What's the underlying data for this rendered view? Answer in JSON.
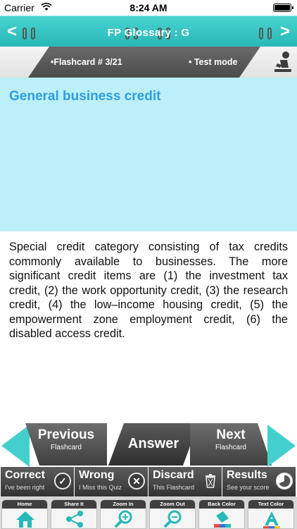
{
  "status_bar": {
    "carrier": "Carrier",
    "time": "8:24 AM"
  },
  "header": {
    "title": "FP Glossary : G",
    "back_icon": "chevron-left-icon",
    "forward_icon": "chevron-right-icon",
    "accent": "#33c3c1"
  },
  "info_bar": {
    "flashcard_label": "•Flashcard #  3/21",
    "mode_label": "• Test mode"
  },
  "card": {
    "term": "General business credit",
    "term_color": "#2d9fe0",
    "term_background": "#bdeff8",
    "definition": "Special credit category consisting of tax credits commonly available to businesses. The more significant credit items are (1) the investment tax credit, (2) the work opportunity credit, (3) the research credit, (4) the low–income housing credit, (5) the empowerment zone employment credit, (6) the disabled access credit."
  },
  "navigation": {
    "previous": {
      "label": "Previous",
      "sub": "Flashcard"
    },
    "answer": {
      "label": "Answer"
    },
    "next": {
      "label": "Next",
      "sub": "Flashcard"
    }
  },
  "actions": [
    {
      "label": "Correct",
      "sub": "I've been right",
      "icon": "checkmark-icon"
    },
    {
      "label": "Wrong",
      "sub": "I Miss this Quiz",
      "icon": "x-icon"
    },
    {
      "label": "Discard",
      "sub": "This Flashcard",
      "icon": "trash-icon"
    },
    {
      "label": "Results",
      "sub": "See your score",
      "icon": "pie-chart-icon"
    }
  ],
  "toolbar": [
    {
      "label": "Home",
      "icon": "home-icon"
    },
    {
      "label": "Share It",
      "icon": "share-icon"
    },
    {
      "label": "Zoom In",
      "icon": "zoom-in-icon"
    },
    {
      "label": "Zoom Out",
      "icon": "zoom-out-icon"
    },
    {
      "label": "Back Color",
      "icon": "paint-bucket-icon"
    },
    {
      "label": "Text Color",
      "icon": "text-color-icon"
    }
  ]
}
